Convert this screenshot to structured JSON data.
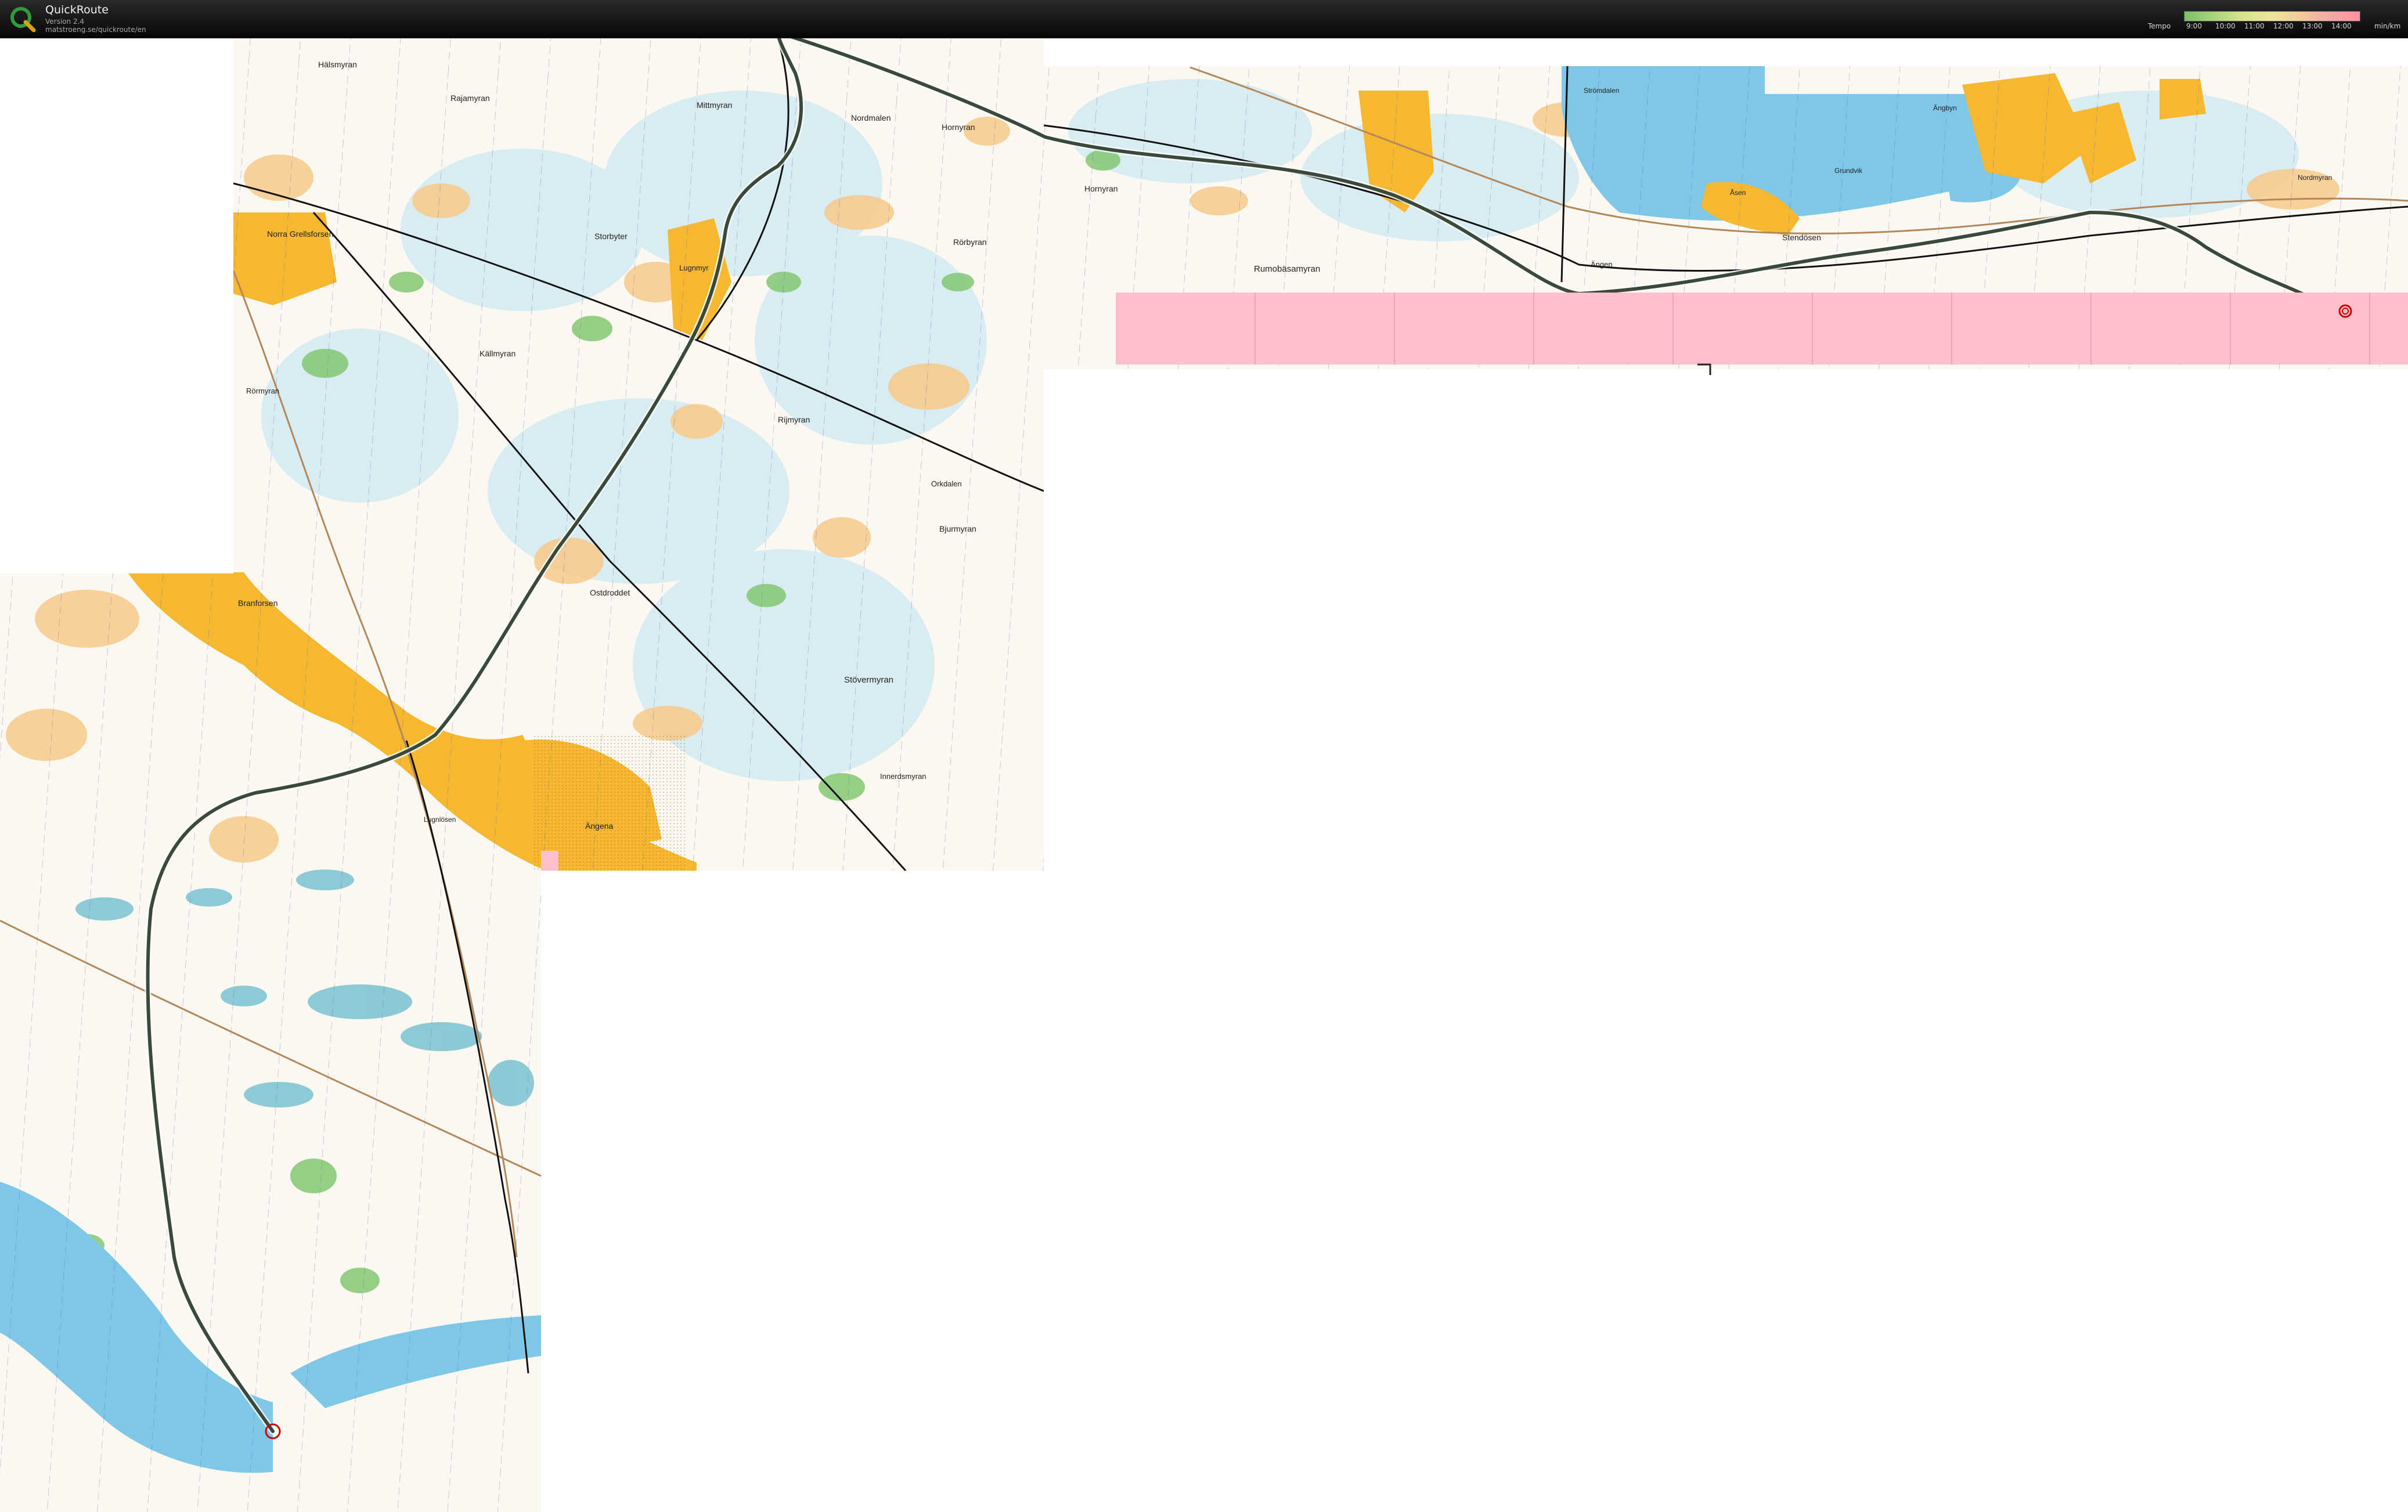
{
  "app": {
    "title": "QuickRoute",
    "version": "Version 2.4",
    "url": "matstroeng.se/quickroute/en"
  },
  "legend": {
    "label": "Tempo",
    "ticks": [
      "9:00",
      "10:00",
      "11:00",
      "12:00",
      "13:00",
      "14:00"
    ],
    "unit": "min/km",
    "gradient_colors": [
      "#7fbf6a",
      "#d6e38a",
      "#f2c99b",
      "#ff8fa0"
    ]
  },
  "map": {
    "colors": {
      "paper": "#ffffff",
      "open_land": "#f7c98a",
      "marsh_light": "#d9ecf2",
      "forest_green": "#7cc46a",
      "water": "#7fc7e6",
      "urban": "#f5b830",
      "missing_tile": "#ffc0cb",
      "route": "#3a4a3a",
      "road": "#111111",
      "railway": "#b4875a",
      "magnetic_north_lines": "#5566aa"
    },
    "place_names": [
      "Hälsmyran",
      "Rajamyran",
      "Mittmyran",
      "Nordmalen",
      "Hornyran",
      "Hornyran",
      "Norra Grellsforsen",
      "Storbyter",
      "Lugnmyr",
      "Rörbyran",
      "Rumobäsamyran",
      "Källmyran",
      "Rörmyran",
      "Rijmyran",
      "Orkdalen",
      "Bjurmyran",
      "Branforsen",
      "Ostdroddet",
      "Stövermyran",
      "Innerdsmyran",
      "Ängena",
      "Lugnlösen",
      "Strömdalen",
      "Grundvik",
      "Ängen",
      "Stendösen",
      "Åsen",
      "Ängbyn",
      "Nordmyran"
    ]
  }
}
